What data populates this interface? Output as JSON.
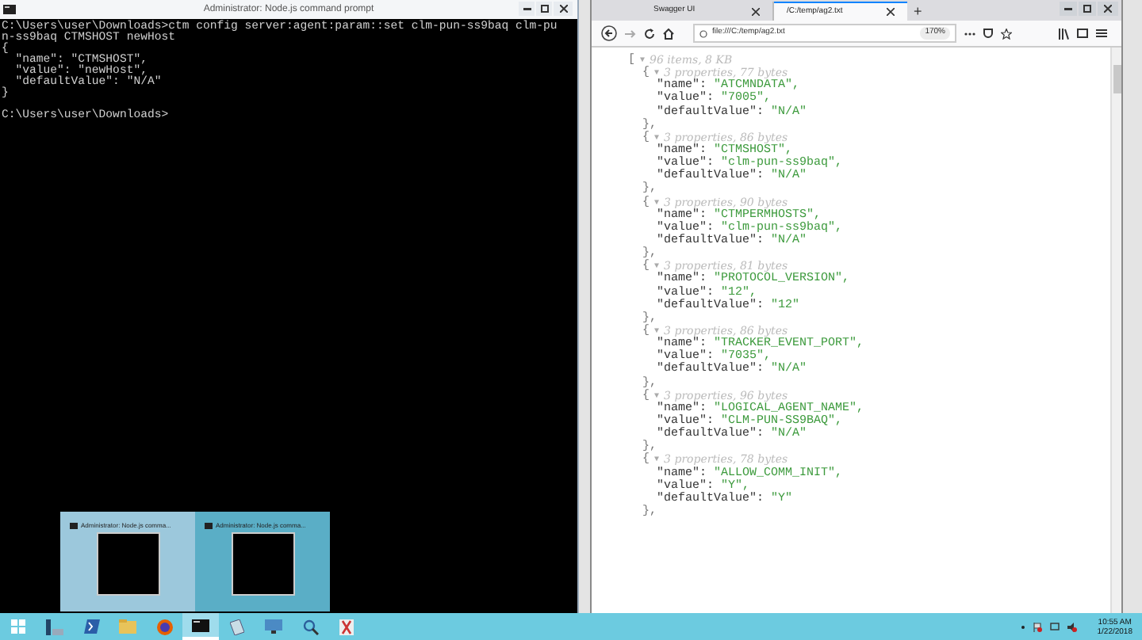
{
  "terminal": {
    "title": "Administrator: Node.js command prompt",
    "lines": [
      {
        "kind": "prompt",
        "text": "C:\\Users\\user\\Downloads>ctm config server:agent:param::set clm-pun-ss9baq clm-pu"
      },
      {
        "kind": "output",
        "text": "n-ss9baq CTMSHOST newHost"
      },
      {
        "kind": "output",
        "text": "{"
      },
      {
        "kind": "output",
        "text": "  \"name\": \"CTMSHOST\","
      },
      {
        "kind": "output",
        "text": "  \"value\": \"newHost\","
      },
      {
        "kind": "output",
        "text": "  \"defaultValue\": \"N/A\""
      },
      {
        "kind": "output",
        "text": "}"
      },
      {
        "kind": "prompt",
        "text": "C:\\Users\\user\\Downloads>"
      }
    ]
  },
  "browser": {
    "tabs": [
      {
        "label": "Swagger UI",
        "selected": false
      },
      {
        "label": "/C:/temp/ag2.txt",
        "selected": true
      }
    ],
    "new_tab": "+",
    "url": "file:///C:/temp/ag2.txt",
    "zoom": "170%",
    "json_viewer": {
      "open": "[",
      "toggle": "▼",
      "summary": "96 items, 8 KB",
      "entries": [
        {
          "open": "{",
          "summary": "3 properties, 77 bytes",
          "properties": [
            {
              "key": "\"name\":",
              "value": "\"ATCMNDATA\","
            },
            {
              "key": "\"value\":",
              "value": "\"7005\","
            },
            {
              "key": "\"defaultValue\":",
              "value": "\"N/A\""
            }
          ],
          "close": "},"
        },
        {
          "open": "{",
          "summary": "3 properties, 86 bytes",
          "properties": [
            {
              "key": "\"name\":",
              "value": "\"CTMSHOST\","
            },
            {
              "key": "\"value\":",
              "value": "\"clm-pun-ss9baq\","
            },
            {
              "key": "\"defaultValue\":",
              "value": "\"N/A\""
            }
          ],
          "close": "},"
        },
        {
          "open": "{",
          "summary": "3 properties, 90 bytes",
          "properties": [
            {
              "key": "\"name\":",
              "value": "\"CTMPERMHOSTS\","
            },
            {
              "key": "\"value\":",
              "value": "\"clm-pun-ss9baq\","
            },
            {
              "key": "\"defaultValue\":",
              "value": "\"N/A\""
            }
          ],
          "close": "},"
        },
        {
          "open": "{",
          "summary": "3 properties, 81 bytes",
          "properties": [
            {
              "key": "\"name\":",
              "value": "\"PROTOCOL_VERSION\","
            },
            {
              "key": "\"value\":",
              "value": "\"12\","
            },
            {
              "key": "\"defaultValue\":",
              "value": "\"12\""
            }
          ],
          "close": "},"
        },
        {
          "open": "{",
          "summary": "3 properties, 86 bytes",
          "properties": [
            {
              "key": "\"name\":",
              "value": "\"TRACKER_EVENT_PORT\","
            },
            {
              "key": "\"value\":",
              "value": "\"7035\","
            },
            {
              "key": "\"defaultValue\":",
              "value": "\"N/A\""
            }
          ],
          "close": "},"
        },
        {
          "open": "{",
          "summary": "3 properties, 96 bytes",
          "properties": [
            {
              "key": "\"name\":",
              "value": "\"LOGICAL_AGENT_NAME\","
            },
            {
              "key": "\"value\":",
              "value": "\"CLM-PUN-SS9BAQ\","
            },
            {
              "key": "\"defaultValue\":",
              "value": "\"N/A\""
            }
          ],
          "close": "},"
        },
        {
          "open": "{",
          "summary": "3 properties, 78 bytes",
          "properties": [
            {
              "key": "\"name\":",
              "value": "\"ALLOW_COMM_INIT\","
            },
            {
              "key": "\"value\":",
              "value": "\"Y\","
            },
            {
              "key": "\"defaultValue\":",
              "value": "\"Y\""
            }
          ],
          "close": "},"
        }
      ]
    }
  },
  "taskbar": {
    "apps": [
      {
        "kind": "start",
        "selected": false
      },
      {
        "kind": "server",
        "selected": false
      },
      {
        "kind": "powershell",
        "selected": false
      },
      {
        "kind": "folder",
        "selected": false
      },
      {
        "kind": "browser",
        "selected": false
      },
      {
        "kind": "terminal",
        "selected": true
      },
      {
        "kind": "document",
        "selected": false
      },
      {
        "kind": "monitor",
        "selected": false
      },
      {
        "kind": "search",
        "selected": false
      },
      {
        "kind": "tools",
        "selected": false
      }
    ],
    "preview": [
      {
        "title": "Administrator: Node.js comma...",
        "selected": true
      },
      {
        "title": "Administrator: Node.js comma...",
        "selected": false
      }
    ],
    "clock": {
      "time": "10:55 AM",
      "date": "1/22/2018"
    }
  }
}
